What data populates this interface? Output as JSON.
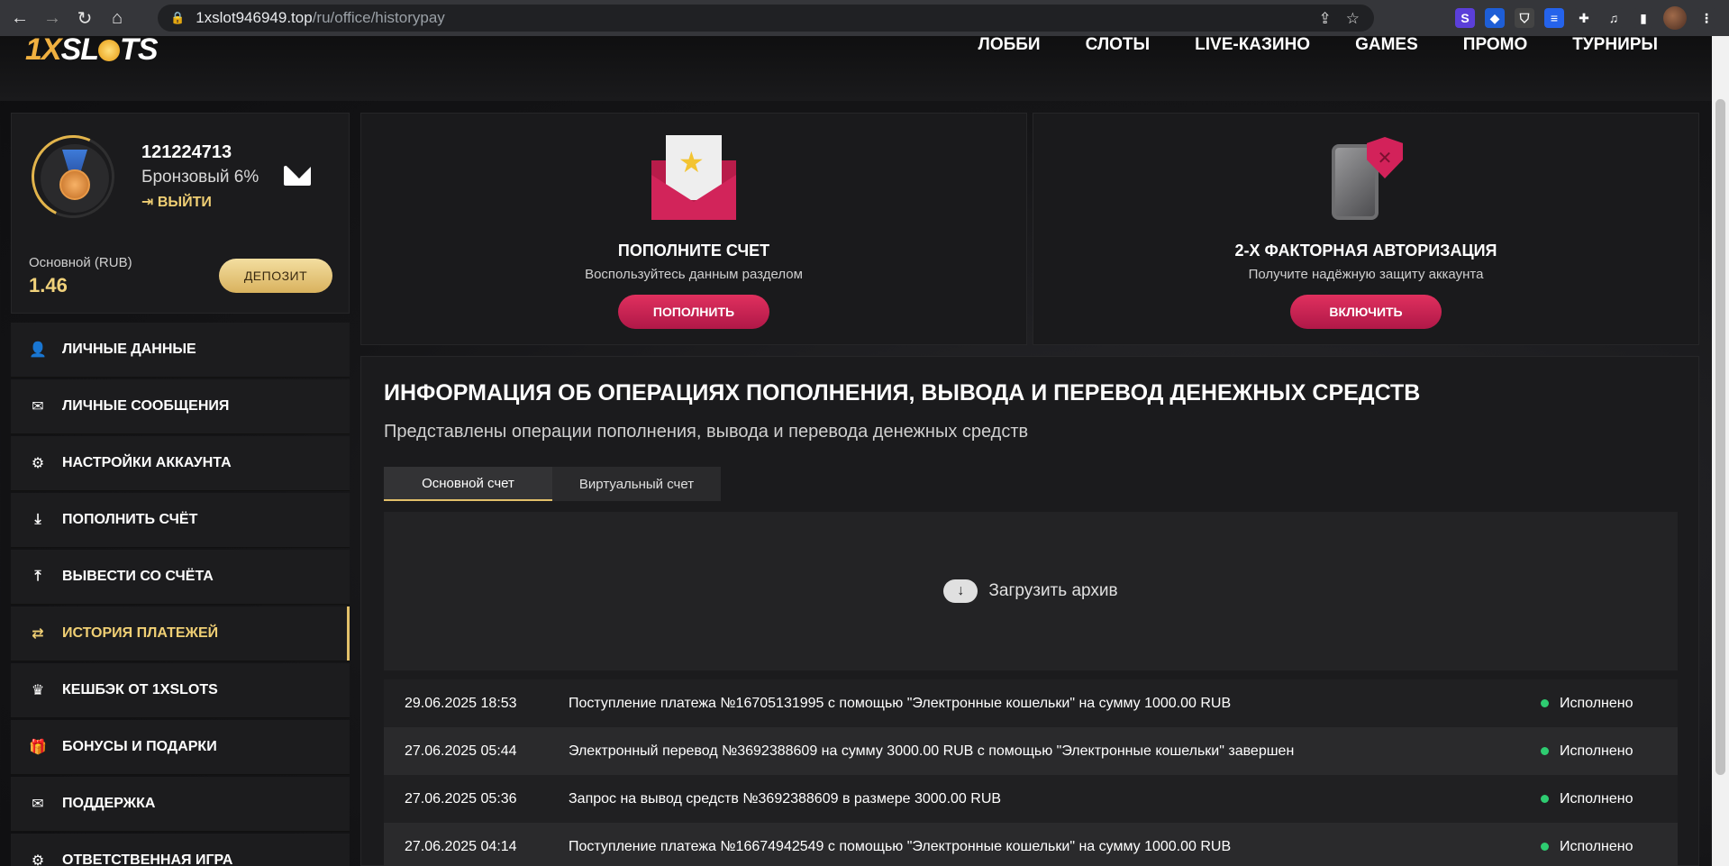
{
  "browser": {
    "url_host": "1xslot946949.top",
    "url_path": "/ru/office/historypay"
  },
  "site": {
    "logo_text_prefix": "1X",
    "logo_text_suffix": "SL",
    "logo_text_end": "TS",
    "nav": [
      "ЛОББИ",
      "СЛОТЫ",
      "LIVE-КАЗИНО",
      "GAMES",
      "ПРОМО",
      "ТУРНИРЫ"
    ]
  },
  "profile": {
    "user_id": "121224713",
    "rank": "Бронзовый 6%",
    "logout": "ВЫЙТИ",
    "balance_label": "Основной (RUB)",
    "balance_value": "1.46",
    "deposit_button": "ДЕПОЗИТ"
  },
  "menu": [
    {
      "label": "ЛИЧНЫЕ ДАННЫЕ",
      "icon": "user-add-icon"
    },
    {
      "label": "ЛИЧНЫЕ СООБЩЕНИЯ",
      "icon": "envelope-icon"
    },
    {
      "label": "НАСТРОЙКИ АККАУНТА",
      "icon": "gears-icon"
    },
    {
      "label": "ПОПОЛНИТЬ СЧЁТ",
      "icon": "download-icon"
    },
    {
      "label": "ВЫВЕСТИ СО СЧЁТА",
      "icon": "upload-icon"
    },
    {
      "label": "ИСТОРИЯ ПЛАТЕЖЕЙ",
      "icon": "transfer-icon"
    },
    {
      "label": "КЕШБЭК ОТ 1XSLOTS",
      "icon": "crown-icon"
    },
    {
      "label": "БОНУСЫ И ПОДАРКИ",
      "icon": "gift-icon"
    },
    {
      "label": "ПОДДЕРЖКА",
      "icon": "envelope-icon"
    },
    {
      "label": "ОТВЕТСТВЕННАЯ ИГРА",
      "icon": "gears-icon"
    }
  ],
  "cards": {
    "deposit": {
      "title": "ПОПОЛНИТЕ СЧЕТ",
      "subtitle": "Воспользуйтесь данным разделом",
      "button": "ПОПОЛНИТЬ"
    },
    "twofa": {
      "title": "2-Х ФАКТОРНАЯ АВТОРИЗАЦИЯ",
      "subtitle": "Получите надёжную защиту аккаунта",
      "button": "ВКЛЮЧИТЬ"
    }
  },
  "main": {
    "title": "ИНФОРМАЦИЯ ОБ ОПЕРАЦИЯХ ПОПОЛНЕНИЯ, ВЫВОДА И ПЕРЕВОД ДЕНЕЖНЫХ СРЕДСТВ",
    "subtitle": "Представлены операции пополнения, вывода и перевода денежных средств",
    "tabs": [
      "Основной счет",
      "Виртуальный счет"
    ],
    "archive_label": "Загрузить архив",
    "rows": [
      {
        "date": "29.06.2025 18:53",
        "text": "Поступление платежа №16705131995 с помощью \"Электронные кошельки\" на сумму 1000.00 RUB",
        "status": "Исполнено"
      },
      {
        "date": "27.06.2025 05:44",
        "text": "Электронный перевод №3692388609 на сумму 3000.00 RUB с помощью \"Электронные кошельки\" завершен",
        "status": "Исполнено"
      },
      {
        "date": "27.06.2025 05:36",
        "text": "Запрос на вывод средств №3692388609 в размере 3000.00 RUB",
        "status": "Исполнено"
      },
      {
        "date": "27.06.2025 04:14",
        "text": "Поступление платежа №16674942549 с помощью \"Электронные кошельки\" на сумму 1000.00 RUB",
        "status": "Исполнено"
      }
    ]
  },
  "colors": {
    "accent_gold": "#e2c06a",
    "accent_pink": "#d3225a",
    "status_ok": "#2ecc71"
  }
}
